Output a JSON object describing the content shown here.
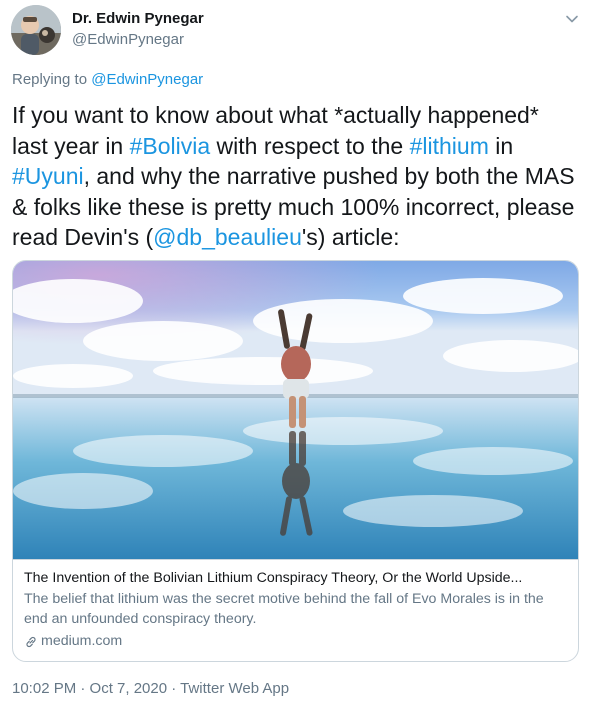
{
  "author": {
    "name": "Dr. Edwin Pynegar",
    "handle": "@EdwinPynegar"
  },
  "reply": {
    "prefix": "Replying to ",
    "mention": "@EdwinPynegar"
  },
  "body": {
    "t1": "If you want to know about what *actually happened* last year in ",
    "tag_bolivia": "#Bolivia",
    "t2": " with respect to the ",
    "tag_lithium": "#lithium",
    "t3": " in ",
    "tag_uyuni": "#Uyuni",
    "t4": ", and why the narrative pushed by both the MAS & folks like these is pretty much 100% incorrect, please read Devin's (",
    "mention": "@db_beaulieu",
    "t5": "'s) article:"
  },
  "card": {
    "title": "The Invention of the Bolivian Lithium Conspiracy Theory, Or the World Upside...",
    "description": "The belief that lithium was the secret motive behind the fall of Evo Morales is in the end an unfounded conspiracy theory.",
    "domain": "medium.com"
  },
  "meta": {
    "timestamp": "10:02 PM · Oct 7, 2020 · Twitter Web App"
  },
  "icons": {
    "menu": "chevron-down-icon",
    "card_link": "link-icon"
  },
  "colors": {
    "link": "#1b95e0",
    "secondary": "#657786",
    "text": "#14171a",
    "border": "#ccd6dd"
  }
}
